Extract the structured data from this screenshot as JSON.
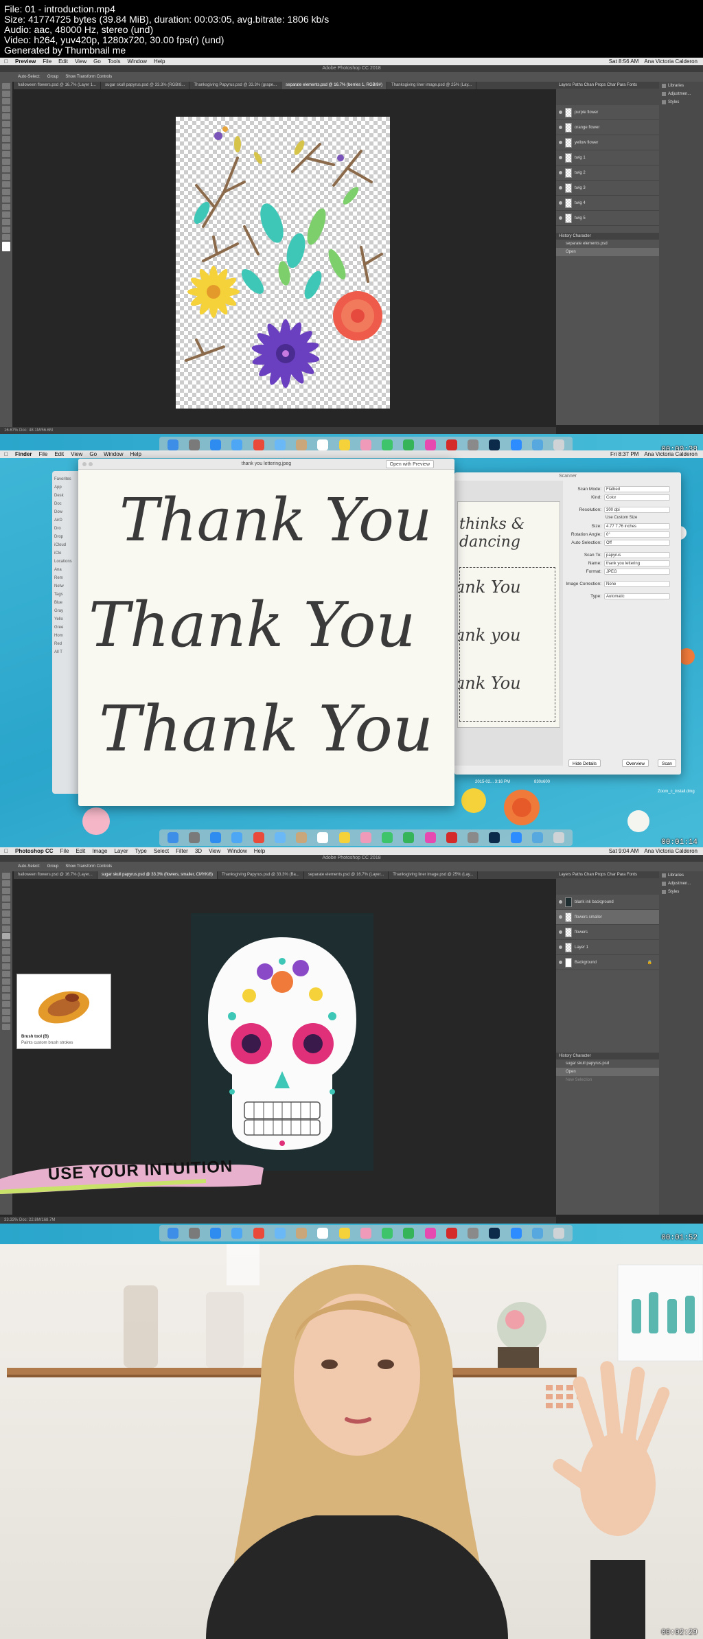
{
  "header": {
    "line1": "File: 01 - introduction.mp4",
    "line2": "Size: 41774725 bytes (39.84 MiB), duration: 00:03:05, avg.bitrate: 1806 kb/s",
    "line3": "Audio: aac, 48000 Hz, stereo (und)",
    "line4": "Video: h264, yuv420p, 1280x720, 30.00 fps(r) (und)",
    "line5": "Generated by Thumbnail me"
  },
  "frame1": {
    "timestamp": "00:00:38",
    "menubar": {
      "app": "Preview",
      "items": [
        "File",
        "Edit",
        "View",
        "Go",
        "Tools",
        "Window",
        "Help"
      ],
      "clock": "Sat 8:56 AM",
      "user": "Ana Victoria Calderon"
    },
    "title": "Adobe Photoshop CC 2018",
    "options": [
      "Auto-Select:",
      "Group",
      "Show Transform Controls"
    ],
    "tabs": [
      "halloween flowers.psd @ 16.7% (Layer 1...",
      "sugar skull papyrus.psd @ 33.3% (RGB/8...",
      "Thanksgiving Papyrus.psd @ 33.3% (grape...",
      "separate elements.psd @ 16.7% (berries 1, RGB/8#)",
      "Thanksgiving liner image.psd @ 25% (Lay..."
    ],
    "active_tab": 3,
    "layers_tabs": "Layers  Paths  Chan  Props  Char  Para  Fonts",
    "layers": [
      "purple flower",
      "orange flower",
      "yellow flower",
      "twig 1",
      "twig 2",
      "twig 3",
      "twig 4",
      "twig 5"
    ],
    "history_tabs": "History  Character",
    "history": [
      "separate elements.psd",
      "Open"
    ],
    "right_strip": [
      "Libraries",
      "Adjustmen...",
      "Styles"
    ],
    "status": "16.67%   Doc: 48.1M/56.6M"
  },
  "frame2": {
    "timestamp": "00:01:14",
    "menubar": {
      "app": "Finder",
      "items": [
        "File",
        "Edit",
        "View",
        "Go",
        "Window",
        "Help"
      ],
      "clock": "Fri 8:37 PM",
      "user": "Ana Victoria Calderon"
    },
    "preview_title": "thank you lettering.jpeg",
    "open_button": "Open with Preview",
    "lettering": [
      "Thank You",
      "Thank You",
      "Thank You"
    ],
    "sidebar": [
      "Favorites",
      "App",
      "Desk",
      "Doc",
      "Dow",
      "AirD",
      "Dro",
      "Drop",
      "iCloud",
      "iClo",
      "Locations",
      "Ana",
      "Rem",
      "Netw",
      "Tags",
      "Blue",
      "Gray",
      "Yello",
      "Gree",
      "Hom",
      "Red",
      "All T"
    ],
    "scanner_title": "Scanner",
    "scan_fields": [
      {
        "label": "Scan Mode:",
        "value": "Flatbed"
      },
      {
        "label": "Kind:",
        "value": "Color"
      },
      {
        "label": "Resolution:",
        "value": "300      dpi"
      },
      {
        "label": "",
        "value": "Use Custom Size"
      },
      {
        "label": "Size:",
        "value": "4.77   7.76   inches"
      },
      {
        "label": "Rotation Angle:",
        "value": "0°"
      },
      {
        "label": "Auto Selection:",
        "value": "Off"
      },
      {
        "label": "Scan To:",
        "value": "papyrus"
      },
      {
        "label": "Name:",
        "value": "thank you lettering"
      },
      {
        "label": "Format:",
        "value": "JPEG"
      },
      {
        "label": "Image Correction:",
        "value": "None"
      },
      {
        "label": "Type:",
        "value": "Automatic"
      }
    ],
    "buttons": [
      "Hide Details",
      "Overview",
      "Scan"
    ],
    "scan_doc_text": [
      "thinks &",
      "dancing",
      "ank You",
      "ank you",
      "ank You"
    ],
    "desktop_file": "2015-02... 3:16 PM",
    "desktop_size": "830x600",
    "desktop_file2": "Zoom_c_install.dmg"
  },
  "frame3": {
    "timestamp": "00:01:52",
    "menubar": {
      "app": "Photoshop CC",
      "items": [
        "File",
        "Edit",
        "Image",
        "Layer",
        "Type",
        "Select",
        "Filter",
        "3D",
        "View",
        "Window",
        "Help"
      ],
      "clock": "Sat 9:04 AM",
      "user": "Ana Victoria Calderon"
    },
    "title": "Adobe Photoshop CC 2018",
    "tabs": [
      "halloween flowers.psd @ 16.7% (Layer...",
      "sugar skull papyrus.psd @ 33.3% (flowers, smaller, CMYK/8)",
      "Thanksgiving Papyrus.psd @ 33.3% (Ba...",
      "separate elements.psd @ 16.7% (Layer...",
      "Thanksgiving liner image.psd @ 25% (Lay..."
    ],
    "active_tab": 1,
    "layers": [
      "blank ink background",
      "flowers smaller",
      "flowers",
      "Layer 1",
      "Background"
    ],
    "selected_layer": 1,
    "history": [
      "sugar skull papyrus.psd",
      "Open",
      "New Selection"
    ],
    "tooltip_name": "Brush tool (B)",
    "tooltip_desc": "Paints custom brush strokes",
    "banner": "USE YOUR INTUITION",
    "status": "33.33%   Doc: 22.8M/168.7M"
  },
  "frame4": {
    "timestamp": "00:02:29"
  },
  "colors": {
    "ps_bg": "#262626",
    "ps_panel": "#535353",
    "desktop": "#2aa5cb",
    "banner": "#e0b4c8",
    "skull_bg": "#1e2d30"
  }
}
